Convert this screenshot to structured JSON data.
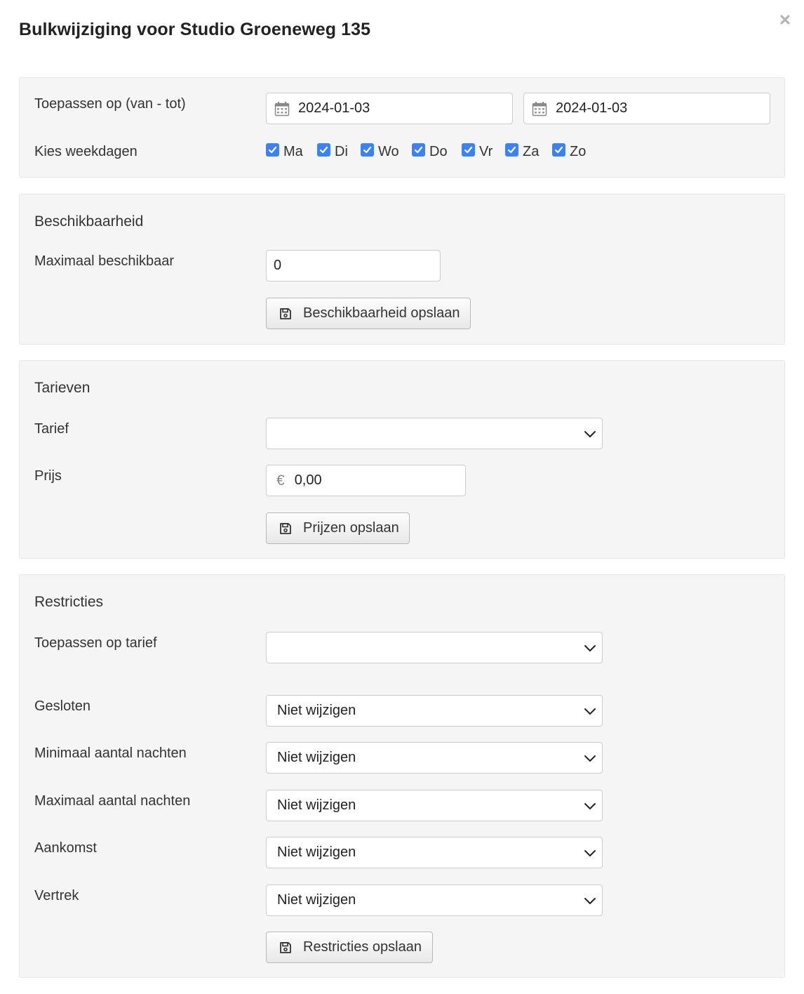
{
  "modal": {
    "title": "Bulkwijziging voor Studio Groeneweg 135",
    "close_icon": "close-icon"
  },
  "period": {
    "apply_label": "Toepassen op (van - tot)",
    "from_date": "2024-01-03",
    "to_date": "2024-01-03",
    "calendar_icon": "calendar-icon",
    "weekdays_label": "Kies weekdagen",
    "weekdays": [
      {
        "label": "Ma",
        "checked": true
      },
      {
        "label": "Di",
        "checked": true
      },
      {
        "label": "Wo",
        "checked": true
      },
      {
        "label": "Do",
        "checked": true
      },
      {
        "label": "Vr",
        "checked": true
      },
      {
        "label": "Za",
        "checked": true
      },
      {
        "label": "Zo",
        "checked": true
      }
    ]
  },
  "availability": {
    "title": "Beschikbaarheid",
    "max_label": "Maximaal beschikbaar",
    "max_value": "0",
    "save_label": "Beschikbaarheid opslaan",
    "save_icon": "floppy-disk-icon"
  },
  "rates": {
    "title": "Tarieven",
    "rate_label": "Tarief",
    "rate_value": "",
    "price_label": "Prijs",
    "currency_symbol": "€",
    "price_value": "0,00",
    "save_label": "Prijzen opslaan"
  },
  "restrictions": {
    "title": "Restricties",
    "apply_rate_label": "Toepassen op tarief",
    "apply_rate_value": "",
    "closed_label": "Gesloten",
    "closed_value": "Niet wijzigen",
    "min_nights_label": "Minimaal aantal nachten",
    "min_nights_value": "Niet wijzigen",
    "max_nights_label": "Maximaal aantal nachten",
    "max_nights_value": "Niet wijzigen",
    "arrival_label": "Aankomst",
    "arrival_value": "Niet wijzigen",
    "departure_label": "Vertrek",
    "departure_value": "Niet wijzigen",
    "save_label": "Restricties opslaan"
  },
  "colors": {
    "checkbox": "#3b82f6",
    "panel_bg": "#f5f5f5"
  }
}
